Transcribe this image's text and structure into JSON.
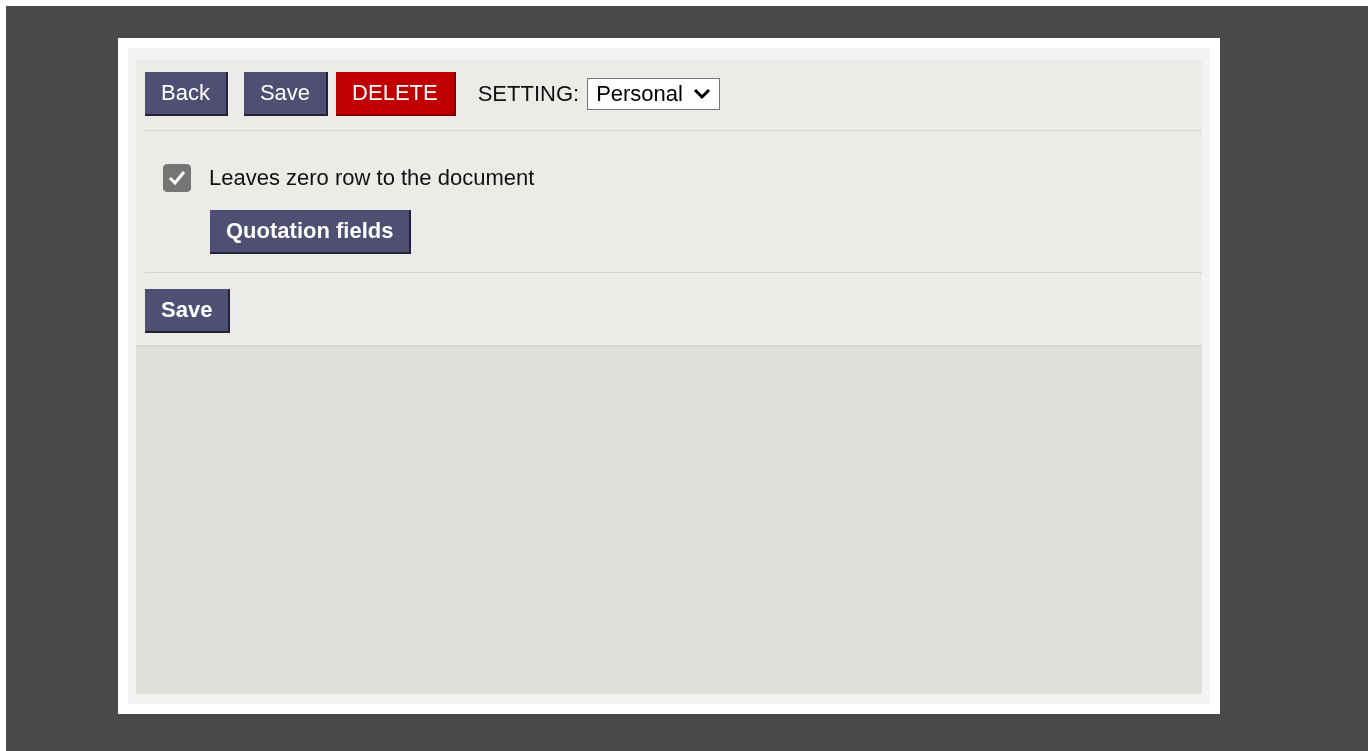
{
  "toolbar": {
    "buttons": [
      {
        "label": "Back",
        "kind": "normal"
      },
      {
        "label": "Save",
        "kind": "normal"
      },
      {
        "label": "DELETE",
        "kind": "danger"
      }
    ],
    "setting": {
      "label": "SETTING:",
      "value": "Personal"
    }
  },
  "options": [
    {
      "label": "Leaves zero row to the document",
      "checked": true
    }
  ],
  "quotation_button": "Quotation fields",
  "footer_button": "Save"
}
